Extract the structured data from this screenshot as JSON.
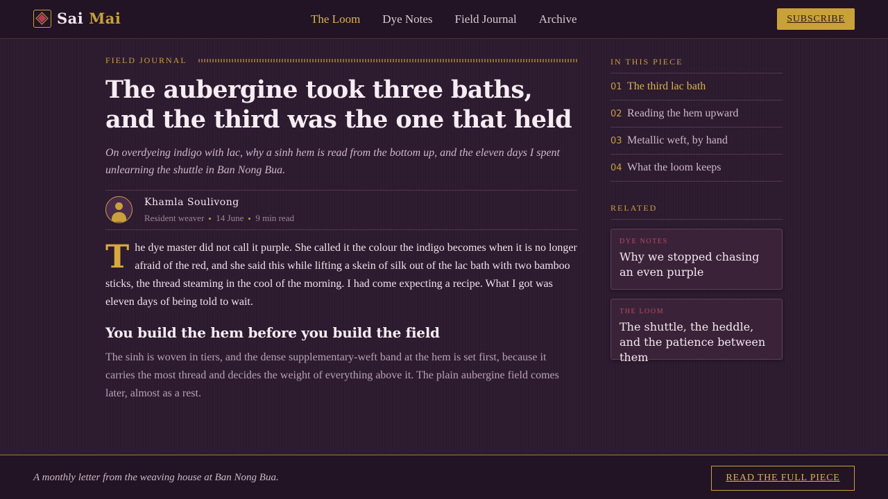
{
  "brand": {
    "name_part1": "Sai",
    "name_part2": "Mai"
  },
  "nav": {
    "items": [
      {
        "label": "The Loom",
        "active": true
      },
      {
        "label": "Dye Notes",
        "active": false
      },
      {
        "label": "Field Journal",
        "active": false
      },
      {
        "label": "Archive",
        "active": false
      }
    ],
    "subscribe_label": "SUBSCRIBE"
  },
  "article": {
    "kicker": "FIELD JOURNAL",
    "title": "The aubergine took three baths, and the third was the one that held",
    "dek": "On overdyeing indigo with lac, why a sinh hem is read from the bottom up, and the eleven days I spent unlearning the shuttle in Ban Nong Bua.",
    "author": {
      "name": "Khamla Soulivong",
      "role": "Resident weaver",
      "date": "14 June",
      "read_time": "9 min read"
    },
    "dropcap": "T",
    "paragraph1": "he dye master did not call it purple. She called it the colour the indigo becomes when it is no longer afraid of the red, and she said this while lifting a skein of silk out of the lac bath with two bamboo sticks, the thread steaming in the cool of the morning. I had come expecting a recipe. What I got was eleven days of being told to wait.",
    "subheading": "You build the hem before you build the field",
    "paragraph2": "The sinh is woven in tiers, and the dense supplementary-weft band at the hem is set first, because it carries the most thread and decides the weight of everything above it. The plain aubergine field comes later, almost as a rest."
  },
  "toc": {
    "heading": "IN THIS PIECE",
    "items": [
      {
        "num": "01",
        "label": "The third lac bath",
        "active": true
      },
      {
        "num": "02",
        "label": "Reading the hem upward",
        "active": false
      },
      {
        "num": "03",
        "label": "Metallic weft, by hand",
        "active": false
      },
      {
        "num": "04",
        "label": "What the loom keeps",
        "active": false
      }
    ]
  },
  "related": {
    "heading": "RELATED",
    "cards": [
      {
        "tag": "Dye Notes",
        "title": "Why we stopped chasing an even purple"
      },
      {
        "tag": "The Loom",
        "title": "The shuttle, the heddle, and the patience between them"
      }
    ]
  },
  "footer": {
    "text": "A monthly letter from the weaving house at Ban Nong Bua.",
    "button_label": "READ THE FULL PIECE"
  },
  "colors": {
    "background": "#2c1a2f",
    "gold_accent": "#c9a13b",
    "crimson_tag": "#b84a62",
    "text_light": "#f3e6ef"
  },
  "icons": {
    "logo": "diamond-logo-icon",
    "avatar": "user-avatar-icon"
  }
}
